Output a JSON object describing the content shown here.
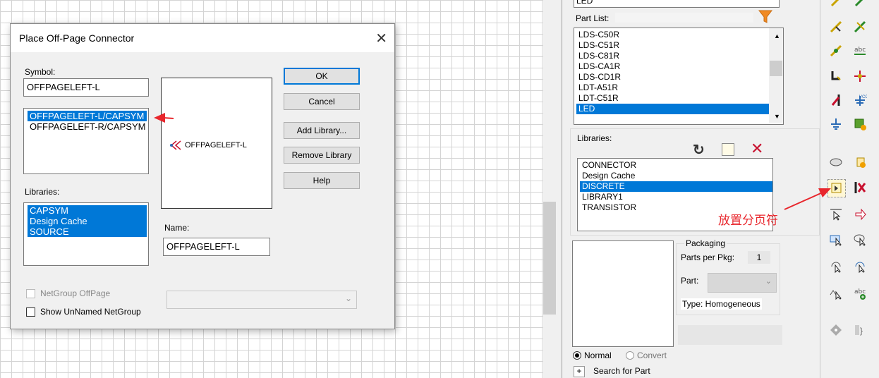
{
  "dialog": {
    "title": "Place Off-Page Connector",
    "symbol_label": "Symbol:",
    "symbol_value": "OFFPAGELEFT-L",
    "symbol_list": [
      {
        "text": "OFFPAGELEFT-L/CAPSYM",
        "selected": true
      },
      {
        "text": "OFFPAGELEFT-R/CAPSYM",
        "selected": false
      }
    ],
    "libraries_label": "Libraries:",
    "libraries_list": [
      {
        "text": "CAPSYM",
        "selected": true
      },
      {
        "text": "Design Cache",
        "selected": true
      },
      {
        "text": "SOURCE",
        "selected": true
      }
    ],
    "preview_text": "OFFPAGELEFT-L",
    "name_label": "Name:",
    "name_value": "OFFPAGELEFT-L",
    "buttons": {
      "ok": "OK",
      "cancel": "Cancel",
      "add_library": "Add Library...",
      "remove_library": "Remove Library",
      "help": "Help"
    },
    "netgroup_offpage": "NetGroup OffPage",
    "show_unnamed": "Show UnNamed NetGroup"
  },
  "panel": {
    "top_field": "LED",
    "part_list_label": "Part List:",
    "part_list": [
      {
        "text": "LDS-C50R",
        "selected": false
      },
      {
        "text": "LDS-C51R",
        "selected": false
      },
      {
        "text": "LDS-C81R",
        "selected": false
      },
      {
        "text": "LDS-CA1R",
        "selected": false
      },
      {
        "text": "LDS-CD1R",
        "selected": false
      },
      {
        "text": "LDT-A51R",
        "selected": false
      },
      {
        "text": "LDT-C51R",
        "selected": false
      },
      {
        "text": "LED",
        "selected": true
      }
    ],
    "libraries_label": "Libraries:",
    "libraries": [
      {
        "text": "CONNECTOR",
        "selected": false
      },
      {
        "text": "Design Cache",
        "selected": false
      },
      {
        "text": "DISCRETE",
        "selected": true
      },
      {
        "text": "LIBRARY1",
        "selected": false
      },
      {
        "text": "TRANSISTOR",
        "selected": false
      }
    ],
    "packaging_label": "Packaging",
    "parts_per_pkg_label": "Parts per Pkg:",
    "parts_per_pkg_value": "1",
    "part_label": "Part:",
    "type_label": "Type: Homogeneous",
    "radio_normal": "Normal",
    "radio_convert": "Convert",
    "search_for_part": "Search for Part",
    "plus": "+"
  },
  "annotation": "放置分页符",
  "colors": {
    "selection": "#0078d7",
    "annotation_red": "#e8262c",
    "filter_orange": "#f08a24"
  }
}
